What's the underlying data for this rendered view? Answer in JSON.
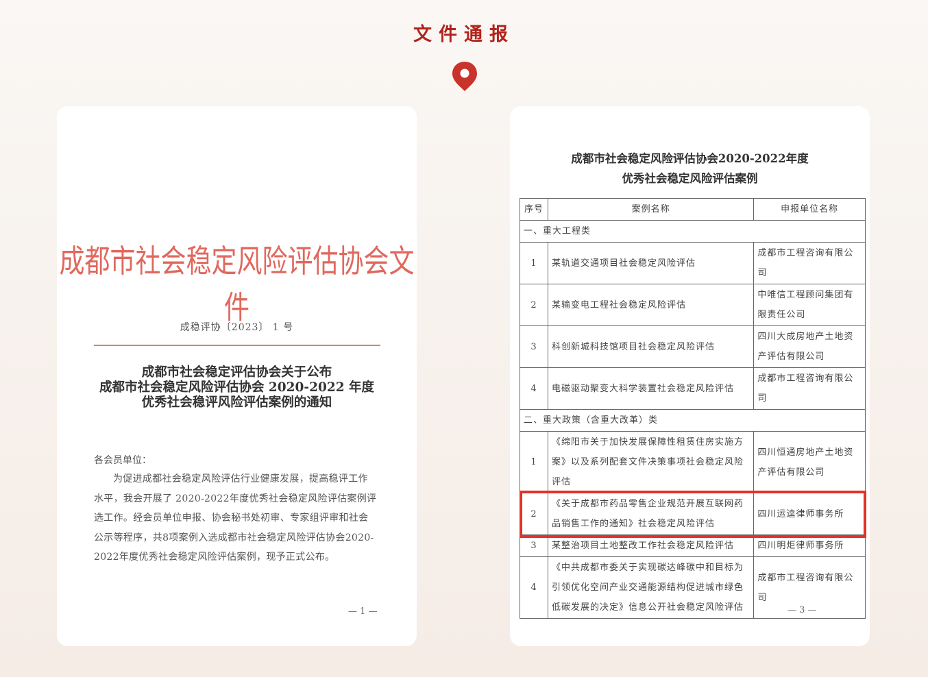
{
  "header": {
    "title": "文件通报",
    "pin_icon": "location-pin-icon",
    "accent_color": "#c8332b"
  },
  "left_document": {
    "org_title": "成都市社会稳定风险评估协会文件",
    "doc_number": "成稳评协〔2023〕 1 号",
    "notice_title": [
      "成都市社会稳定评估协会关于公布",
      "成都市社会稳定风险评估协会 2020-2022 年度",
      "优秀社会稳评风险评估案例的通知"
    ],
    "salutation": "各会员单位：",
    "body_lines": [
      "为促进成都社会稳定风险评估行业健康发展，提高稳评工作",
      "水平，我会开展了 2020-2022年度优秀社会稳定风险评估案例评",
      "选工作。经会员单位申报、协会秘书处初审、专家组评审和社会",
      "公示等程序，共8项案例入选成都市社会稳定风险评估协会2020-",
      "2022年度优秀社会稳定风险评估案例，现予正式公布。"
    ],
    "page_number": "— 1 —"
  },
  "right_document": {
    "title_lines": [
      "成都市社会稳定风险评估协会2020-2022年度",
      "优秀社会稳定风险评估案例"
    ],
    "table": {
      "headers": [
        "序号",
        "案例名称",
        "申报单位名称"
      ],
      "sections": [
        {
          "label": "一、重大工程类",
          "rows": [
            {
              "seq": "1",
              "name": "某轨道交通项目社会稳定风险评估",
              "unit": "成都市工程咨询有限公司"
            },
            {
              "seq": "2",
              "name": "某输变电工程社会稳定风险评估",
              "unit": "中唯信工程顾问集团有限责任公司"
            },
            {
              "seq": "3",
              "name": "科创新城科技馆项目社会稳定风险评估",
              "unit": "四川大成房地产土地资产评估有限公司"
            },
            {
              "seq": "4",
              "name": "电磁驱动聚变大科学装置社会稳定风险评估",
              "unit": "成都市工程咨询有限公司"
            }
          ]
        },
        {
          "label": "二、重大政策（含重大改革）类",
          "rows": [
            {
              "seq": "1",
              "name": "《绵阳市关于加快发展保障性租赁住房实施方案》以及系列配套文件决策事项社会稳定风险评估",
              "unit": "四川恒通房地产土地资产评估有限公司"
            },
            {
              "seq": "2",
              "name": "《关于成都市药品零售企业规范开展互联网药品销售工作的通知》社会稳定风险评估",
              "unit": "四川运逵律师事务所",
              "highlighted": true
            },
            {
              "seq": "3",
              "name": "某整治项目土地整改工作社会稳定风险评估",
              "unit": "四川明炬律师事务所"
            },
            {
              "seq": "4",
              "name": "《中共成都市委关于实现碳达峰碳中和目标为引领优化空间产业交通能源结构促进城市绿色低碳发展的决定》信息公开社会稳定风险评估",
              "unit": "成都市工程咨询有限公司"
            }
          ]
        }
      ]
    },
    "highlight_color": "#e53226",
    "page_number": "— 3 —"
  }
}
